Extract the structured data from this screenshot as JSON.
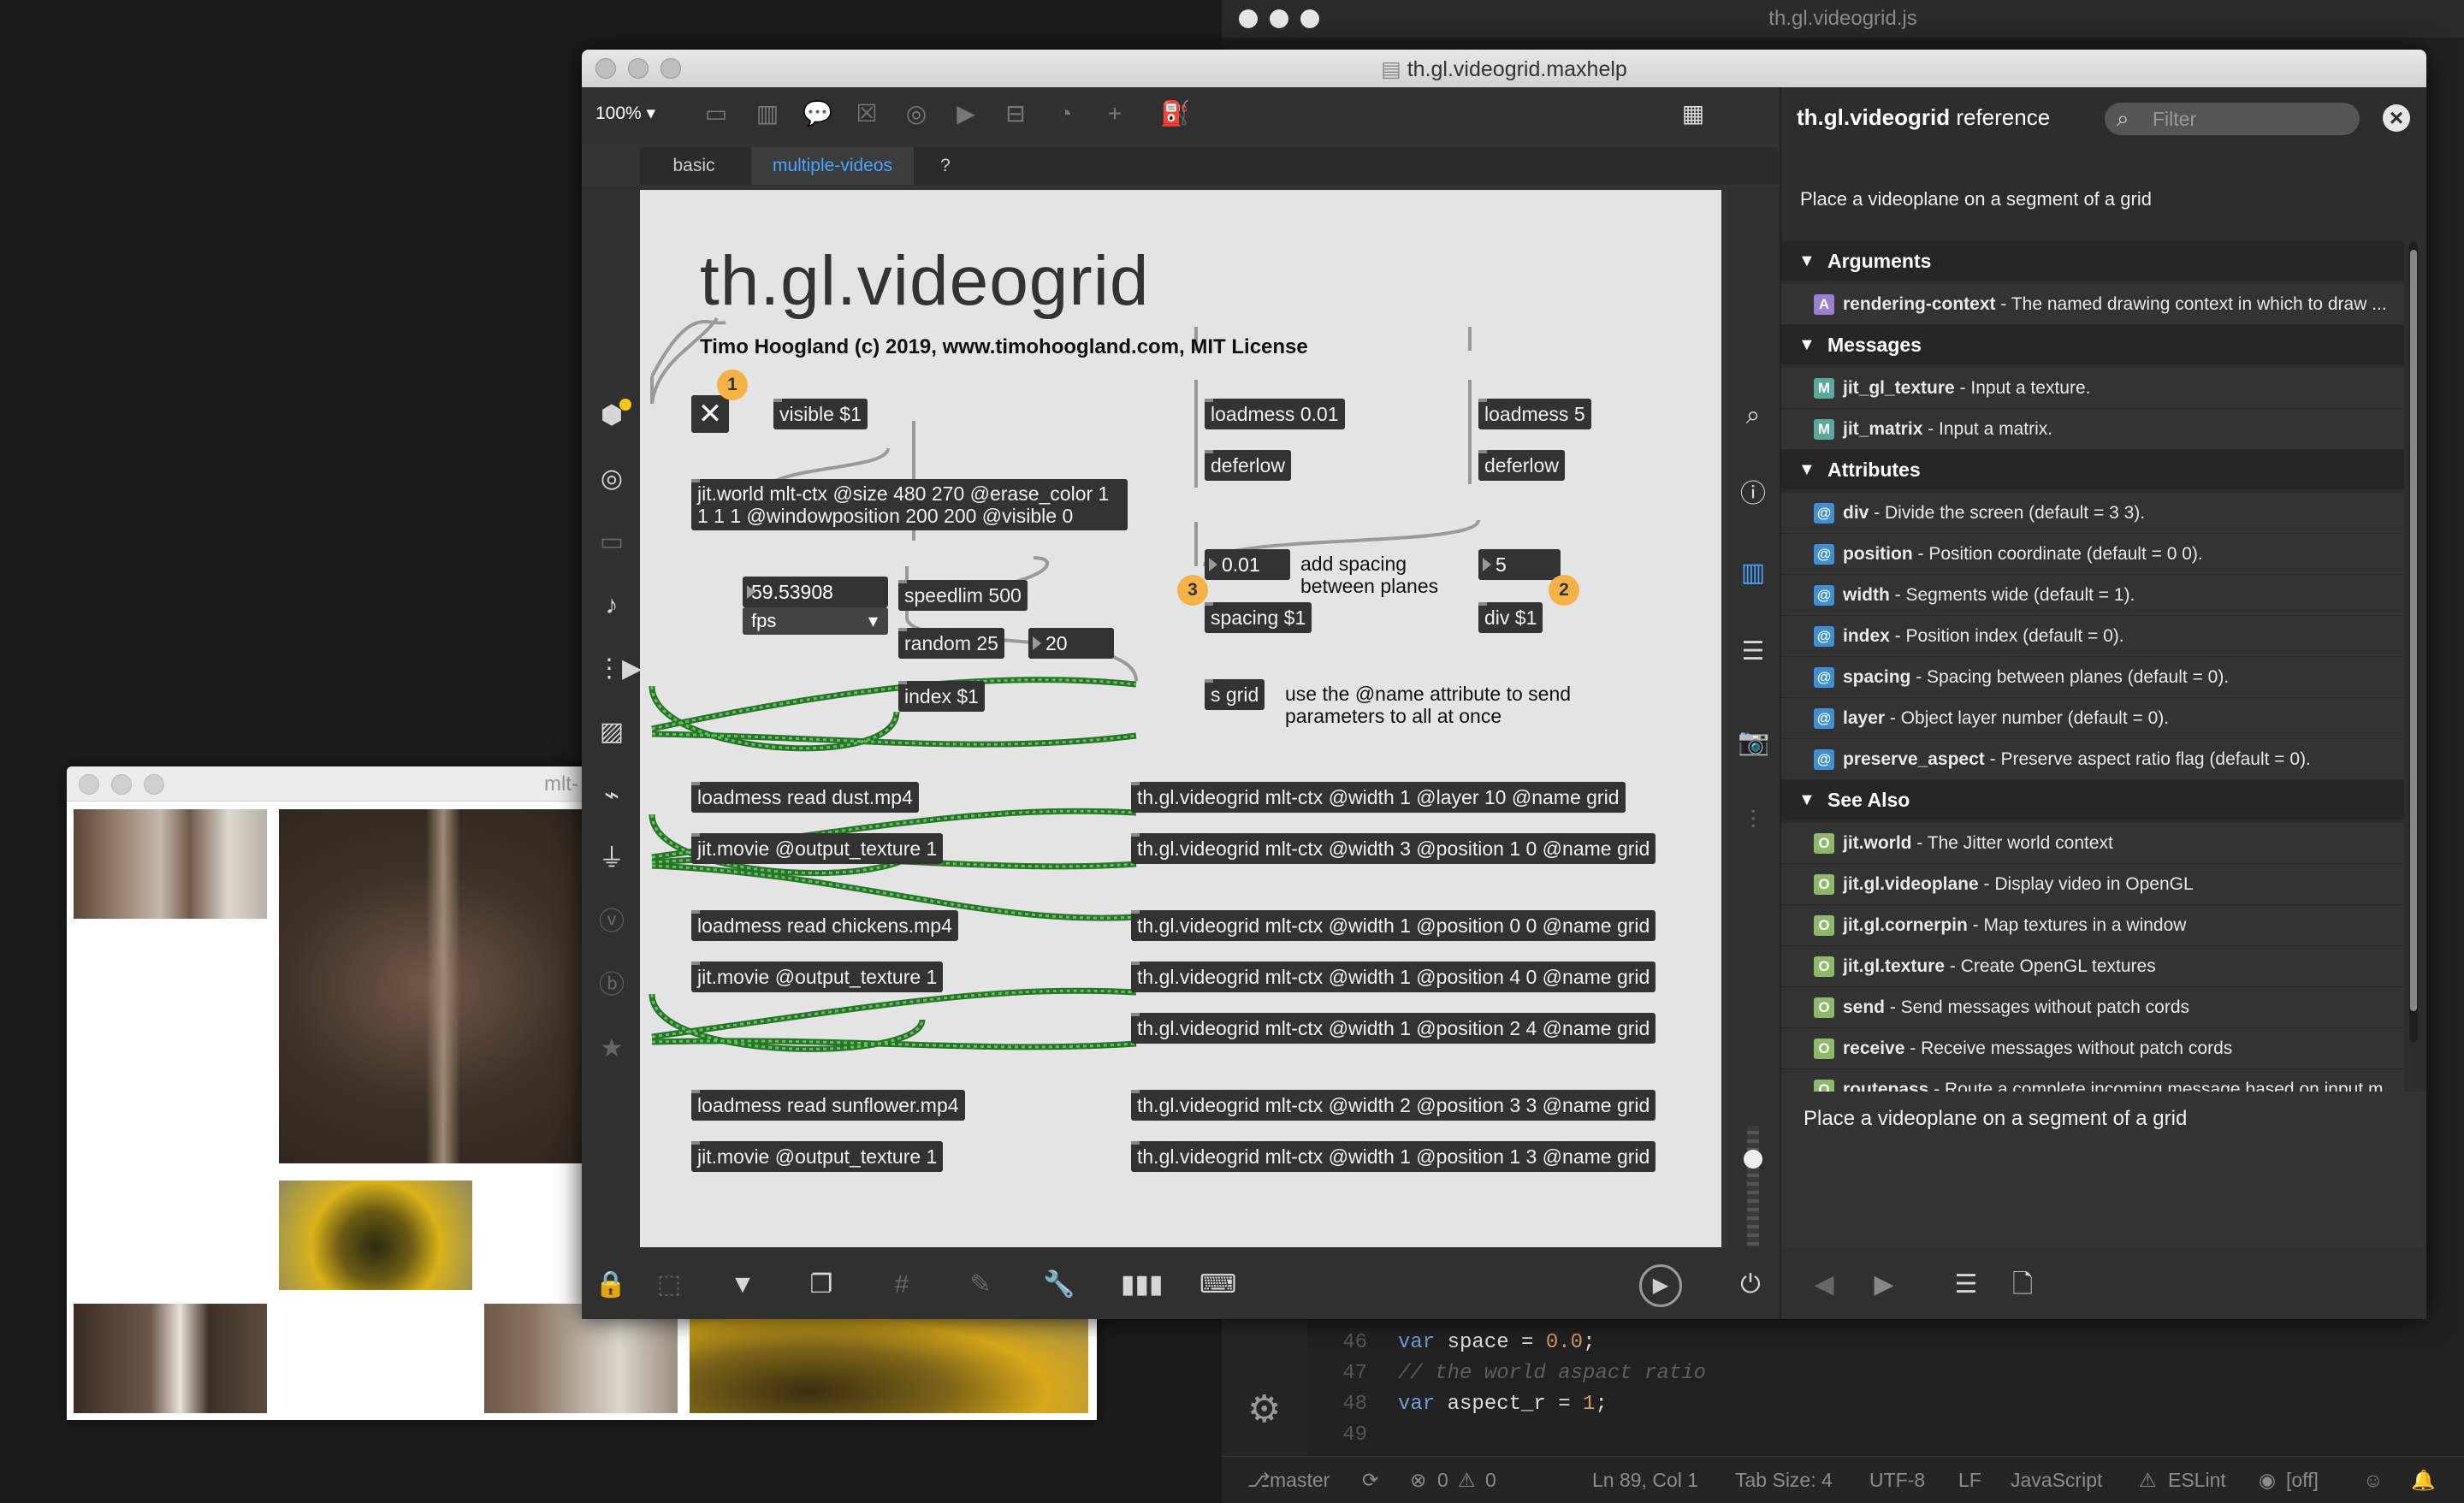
{
  "editor": {
    "title": "th.gl.videogrid.js",
    "lines": [
      {
        "n": "46",
        "code": [
          {
            "t": "var ",
            "c": "kw"
          },
          {
            "t": "space",
            "c": ""
          },
          {
            "t": " = ",
            "c": ""
          },
          {
            "t": "0.0",
            "c": "num"
          },
          {
            "t": ";",
            "c": ""
          }
        ]
      },
      {
        "n": "47",
        "code": [
          {
            "t": "// the world aspact ratio",
            "c": "cm"
          }
        ]
      },
      {
        "n": "48",
        "code": [
          {
            "t": "var ",
            "c": "kw"
          },
          {
            "t": "aspect_r",
            "c": ""
          },
          {
            "t": " = ",
            "c": ""
          },
          {
            "t": "1",
            "c": "num"
          },
          {
            "t": ";",
            "c": ""
          }
        ]
      },
      {
        "n": "49",
        "code": []
      }
    ],
    "status": {
      "branch": "master",
      "errors": "0",
      "warnings": "0",
      "position": "Ln 89, Col 1",
      "tab_size": "Tab Size: 4",
      "encoding": "UTF-8",
      "eol": "LF",
      "language": "JavaScript",
      "linter": "ESLint",
      "off": "[off]"
    }
  },
  "preview": {
    "title": "mlt-"
  },
  "help": {
    "title": "th.gl.videogrid.maxhelp",
    "zoom": "100%",
    "tabs": [
      "basic",
      "multiple-videos",
      "?"
    ],
    "active_tab": "multiple-videos",
    "patcher": {
      "heading": "th.gl.videogrid",
      "author": "Timo Hoogland (c) 2019, www.timohoogland.com, MIT License",
      "objects": {
        "visible": "visible $1",
        "jitworld": "jit.world mlt-ctx @size 480 270 @erase_color 1 1 1 1 @windowposition 200 200 @visible 0",
        "fps_value": "59.53908",
        "fps_menu": "fps",
        "speedlim": "speedlim 500",
        "random": "random 25",
        "random_out": "20",
        "index": "index $1",
        "loadmess1": "loadmess 0.01",
        "deferlow1": "deferlow",
        "spacing_num": "0.01",
        "spacing": "spacing $1",
        "sgrid": "s grid",
        "loadmess5": "loadmess 5",
        "deferlow2": "deferlow",
        "div_num": "5",
        "div": "div $1",
        "read_dust": "loadmess read dust.mp4",
        "movie1": "jit.movie @output_texture 1",
        "read_chickens": "loadmess read chickens.mp4",
        "movie2": "jit.movie @output_texture 1",
        "read_sunflower": "loadmess read sunflower.mp4",
        "movie3": "jit.movie @output_texture 1",
        "vg1": "th.gl.videogrid mlt-ctx @width 1 @layer 10 @name grid",
        "vg2": "th.gl.videogrid mlt-ctx @width 3 @position 1 0 @name grid",
        "vg3": "th.gl.videogrid mlt-ctx @width 1 @position 0 0 @name grid",
        "vg4": "th.gl.videogrid mlt-ctx @width 1 @position 4 0 @name grid",
        "vg5": "th.gl.videogrid mlt-ctx @width 1 @position 2 4 @name grid",
        "vg6": "th.gl.videogrid mlt-ctx @width 2 @position 3 3 @name grid",
        "vg7": "th.gl.videogrid mlt-ctx @width 1 @position 1 3 @name grid"
      },
      "comments": {
        "spacing": "add spacing between planes",
        "name_attr": "use the @name attribute to send parameters to all at once"
      },
      "badges": [
        "1",
        "3",
        "2"
      ]
    }
  },
  "reference": {
    "title_bold": "th.gl.videogrid",
    "title_rest": " reference",
    "filter_placeholder": "Filter",
    "description": "Place a videoplane on a segment of a grid",
    "sections": [
      {
        "name": "Arguments",
        "items": [
          {
            "icon": "A",
            "color": "#9b7fd1",
            "name": "rendering-context",
            "desc": " - The named drawing context in which to draw ..."
          }
        ]
      },
      {
        "name": "Messages",
        "items": [
          {
            "icon": "M",
            "color": "#5aa99e",
            "name": "jit_gl_texture",
            "desc": " - Input a texture."
          },
          {
            "icon": "M",
            "color": "#5aa99e",
            "name": "jit_matrix",
            "desc": " - Input a matrix."
          }
        ]
      },
      {
        "name": "Attributes",
        "items": [
          {
            "icon": "@",
            "color": "#3f8fd6",
            "name": "div",
            "desc": " - Divide the screen (default = 3 3)."
          },
          {
            "icon": "@",
            "color": "#3f8fd6",
            "name": "position",
            "desc": " - Position coordinate (default = 0 0)."
          },
          {
            "icon": "@",
            "color": "#3f8fd6",
            "name": "width",
            "desc": " - Segments wide (default = 1)."
          },
          {
            "icon": "@",
            "color": "#3f8fd6",
            "name": "index",
            "desc": " - Position index (default = 0)."
          },
          {
            "icon": "@",
            "color": "#3f8fd6",
            "name": "spacing",
            "desc": " - Spacing between planes (default = 0)."
          },
          {
            "icon": "@",
            "color": "#3f8fd6",
            "name": "layer",
            "desc": " - Object layer number (default = 0)."
          },
          {
            "icon": "@",
            "color": "#3f8fd6",
            "name": "preserve_aspect",
            "desc": " - Preserve aspect ratio flag (default = 0)."
          }
        ]
      },
      {
        "name": "See Also",
        "items": [
          {
            "icon": "O",
            "color": "#8eb86a",
            "name": "jit.world",
            "desc": " - The Jitter world context"
          },
          {
            "icon": "O",
            "color": "#8eb86a",
            "name": "jit.gl.videoplane",
            "desc": " - Display video in OpenGL"
          },
          {
            "icon": "O",
            "color": "#8eb86a",
            "name": "jit.gl.cornerpin",
            "desc": " - Map textures in a window"
          },
          {
            "icon": "O",
            "color": "#8eb86a",
            "name": "jit.gl.texture",
            "desc": " - Create OpenGL textures"
          },
          {
            "icon": "O",
            "color": "#8eb86a",
            "name": "send",
            "desc": " - Send messages without patch cords"
          },
          {
            "icon": "O",
            "color": "#8eb86a",
            "name": "receive",
            "desc": " - Receive messages without patch cords"
          },
          {
            "icon": "O",
            "color": "#8eb86a",
            "name": "routepass",
            "desc": " - Route a complete incoming message based on input m..."
          }
        ]
      }
    ],
    "bottom_description": "Place a videoplane on a segment of a grid"
  },
  "colors": {
    "accent_blue": "#4aa3ff",
    "badge": "#f5b347",
    "cord_green": "#4ccf4c"
  }
}
